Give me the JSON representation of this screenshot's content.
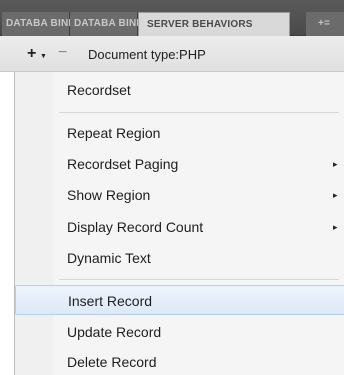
{
  "tabs": [
    {
      "label": "DATABA BINDIN"
    },
    {
      "label": "DATABA BINDIN"
    },
    {
      "label": "SERVER BEHAVIORS"
    },
    {
      "label": "+="
    }
  ],
  "toolbar": {
    "add_icon": "plus-icon",
    "remove_icon": "minus-icon",
    "document_type": "Document type:PHP"
  },
  "menu": {
    "items": [
      {
        "label": "Recordset",
        "submenu": false
      },
      {
        "label": "Repeat Region",
        "submenu": false
      },
      {
        "label": "Recordset Paging",
        "submenu": true
      },
      {
        "label": "Show Region",
        "submenu": true
      },
      {
        "label": "Display Record Count",
        "submenu": true
      },
      {
        "label": "Dynamic Text",
        "submenu": false
      },
      {
        "label": "Insert Record",
        "submenu": false,
        "highlighted": true
      },
      {
        "label": "Update Record",
        "submenu": false
      },
      {
        "label": "Delete Record",
        "submenu": false
      }
    ],
    "submenu_arrow": "▸"
  }
}
